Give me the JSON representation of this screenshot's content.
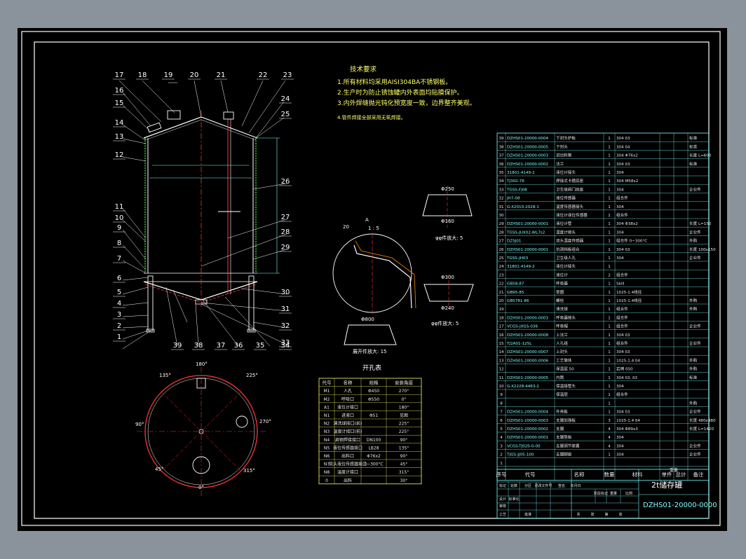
{
  "colors": {
    "background": "#000000",
    "frame": "#ffffff",
    "line": "#7fffff",
    "text": "#ffffff",
    "accent": "#ff3333",
    "green": "#33cc33",
    "yellow": "#ffff66"
  },
  "tech_req": {
    "title": "技术要求",
    "lines": [
      "1.所有材料均采用AISI304BA不锈钢板。",
      "2.生产时为防止锈蚀罐内外表面均贴膜保护。",
      "3.内外焊缝抛光钝化预宽度一致，边界整齐美观。",
      "4.管件焊接全部采用无氧焊接。"
    ]
  },
  "balloons_top": [
    "17",
    "18",
    "19",
    "20",
    "21",
    "22",
    "23"
  ],
  "balloons_left": [
    "16",
    "15",
    "14",
    "13",
    "12",
    "11",
    "10",
    "9",
    "8",
    "7",
    "6",
    "5",
    "4",
    "3",
    "2",
    "1"
  ],
  "balloons_right": [
    "24",
    "25",
    "26",
    "27",
    "28",
    "29",
    "30",
    "31",
    "32",
    "33",
    "34"
  ],
  "balloons_bottom": [
    "39",
    "38",
    "37",
    "36",
    "35"
  ],
  "detail_labels": {
    "scale1": "1 : 5",
    "a": "A",
    "d": "20",
    "cone_top": "Φ250",
    "cone_bottom": "Φ160",
    "cone_tag": "φφ件放大: 5",
    "cone2_top": "Φ300",
    "cone2_bottom": "Φ240",
    "cone2_tag": "φφ件放大: 5",
    "ring": "Φ800",
    "ring_tag": "展开件放大: 15"
  },
  "hole_table": {
    "title": "开孔表",
    "headers": [
      "代号",
      "名称",
      "规格",
      "安装角度"
    ],
    "rows": [
      [
        "M1",
        "人孔",
        "Φ450",
        "270°"
      ],
      [
        "M2",
        "呼吸口",
        "Φ550",
        "0°"
      ],
      [
        "A1",
        "液位计接口",
        "",
        "180°"
      ],
      [
        "N1",
        "进液口",
        "Φ51",
        "见图"
      ],
      [
        "N2",
        "清洗球接口(前)",
        "",
        "225°"
      ],
      [
        "N3",
        "温度计接口(前)",
        "",
        "225°"
      ],
      [
        "N4",
        "扁钢焊接接口",
        "DN100",
        "90°"
      ],
      [
        "N5",
        "液位传感器接口",
        "LB28",
        "135°"
      ],
      [
        "N6",
        "出料口",
        "Φ76x2",
        "90°"
      ],
      [
        "N7",
        "双头液位传感器接口",
        "0~300°C",
        "45°"
      ],
      [
        "N8",
        "温度计接口",
        "",
        "315°"
      ],
      [
        "0",
        "出料",
        "",
        "30°"
      ]
    ]
  },
  "plan_angles": [
    "180°",
    "225°",
    "270°",
    "315°",
    "0°",
    "45°",
    "90°",
    "135°"
  ],
  "parts_headers": [
    "序号",
    "代号",
    "名称",
    "数量",
    "材料",
    "单件",
    "总计",
    "备注"
  ],
  "parts_weight_header": "重量",
  "parts": [
    [
      "39",
      "DZHS01-20000-0004",
      "下封头护板",
      "1",
      "304 δ3",
      "标准"
    ],
    [
      "38",
      "DZHS01-20000-0005",
      "下封头",
      "1",
      "304 δ4",
      "标准"
    ],
    [
      "37",
      "DZHS01-20000-0003",
      "进出料管",
      "1",
      "304 Φ76x2",
      "长度 L=600"
    ],
    [
      "36",
      "DZHS01-20000-0002",
      "法兰",
      "1",
      "304 δ3",
      "标准"
    ],
    [
      "35",
      "31801-4149-2",
      "液位计接头",
      "1",
      "304",
      ""
    ],
    [
      "34",
      "TJ302-76",
      "焊接式卡箍底座",
      "1",
      "304 M58x2",
      ""
    ],
    [
      "33",
      "TGSS-FJ08",
      "卫生级阀门底座",
      "1",
      "304",
      "企业件"
    ],
    [
      "32",
      "JH7-08",
      "液位传感器",
      "1",
      "组合件",
      ""
    ],
    [
      "31",
      "G-X2010-2028-1",
      "温度传感器接头",
      "1",
      "304",
      ""
    ],
    [
      "30",
      "",
      "液位计液位传感器",
      "1",
      "组合件",
      ""
    ],
    [
      "29",
      "DZHS01-20000-0001",
      "液位计管",
      "1",
      "304 Φ38x2",
      "长度 L=150"
    ],
    [
      "28",
      "TGSS-JUX02-WL7s2",
      "温度计接头",
      "1",
      "304",
      "企业件"
    ],
    [
      "27",
      "DZSJ01",
      "双头温度传感器",
      "1",
      "组合件 0~300°C",
      "外购"
    ],
    [
      "26",
      "DZHS01-20000-0001",
      "抗涡挡板组合",
      "1",
      "304 δ3",
      "长度 100x150"
    ],
    [
      "25",
      "TGSS-JH03",
      "卫生级人孔",
      "1",
      "304",
      "企业件"
    ],
    [
      "24",
      "31801-4149-2",
      "液位计接头",
      "1",
      "",
      ""
    ],
    [
      "23",
      "",
      "液位计",
      "2",
      "组合件",
      ""
    ],
    [
      "22",
      "GB58-87",
      "呼吸器",
      "1",
      "Skill",
      ""
    ],
    [
      "21",
      "GB95-85",
      "垫圈",
      "1",
      "1025-1.4线径",
      ""
    ],
    [
      "20",
      "GB5781-86",
      "螺栓",
      "1",
      "1025-1.4线径",
      "外购"
    ],
    [
      "19",
      "",
      "清洗球",
      "1",
      "组合件",
      "外购"
    ],
    [
      "18",
      "DZHS01-20000-0003",
      "呼吸器接头",
      "1",
      "组合件",
      ""
    ],
    [
      "17",
      "VCGS-JXGS-036",
      "呼吸帽",
      "1",
      "组合件",
      "企业件"
    ],
    [
      "16",
      "DZHS01-20000-0008",
      "上法兰",
      "1",
      "304 δ3",
      ""
    ],
    [
      "15",
      "TJ2A01-125L",
      "人孔组",
      "1",
      "组合件",
      "企业件"
    ],
    [
      "14",
      "DZHS01-20000-0007",
      "上封头",
      "1",
      "304 δ3",
      ""
    ],
    [
      "13",
      "DZHS01-20000-0006",
      "工艺筒体",
      "1",
      "1025-1.4 δ4",
      "外购"
    ],
    [
      "12",
      "",
      "保温层 50",
      "1",
      "岩棉 δ50",
      "外购"
    ],
    [
      "11",
      "DZHS01-20000-0005",
      "内筒",
      "1",
      "304 δ3, δ3",
      "标准"
    ],
    [
      "10",
      "G-X2228-4463-2",
      "保温接管头",
      "1",
      "304",
      ""
    ],
    [
      "9",
      "",
      "保温层",
      "1",
      "组合件",
      ""
    ],
    [
      "8",
      "",
      "",
      "1",
      "",
      "外购"
    ],
    [
      "7",
      "DZHS01-20000-0004",
      "外壳板",
      "1",
      "304 δ3",
      "企业件"
    ],
    [
      "6",
      "DZHS01-20000-0003",
      "支腿加强板",
      "3",
      "1025-1.4 δ4",
      "长度 480x480"
    ],
    [
      "5",
      "DZHS01-20000-0002",
      "支腿",
      "4",
      "304 Φ89x3",
      "长度 L=1420"
    ],
    [
      "4",
      "DZHS01-20000-0001",
      "支腿垫板",
      "4",
      "304",
      ""
    ],
    [
      "3",
      "VCGS-TJ020-0-00",
      "支腿调节装置",
      "4",
      "304",
      "企业件"
    ],
    [
      "2",
      "TJGS-JJ05-100",
      "支腿脚座",
      "1",
      "304",
      "企业件"
    ],
    [
      "1",
      "",
      "",
      "",
      "",
      ""
    ]
  ],
  "title_block": {
    "product": "2t储存罐",
    "drawing_no": "DZHS01-20000-0000",
    "labels": [
      "标记",
      "处数",
      "分区",
      "更改文件号",
      "签名",
      "年月日",
      "设计",
      "标准化",
      "审核",
      "工艺",
      "批准",
      "阶段标记",
      "重量",
      "比例",
      "共",
      "张",
      "第",
      "张"
    ]
  }
}
